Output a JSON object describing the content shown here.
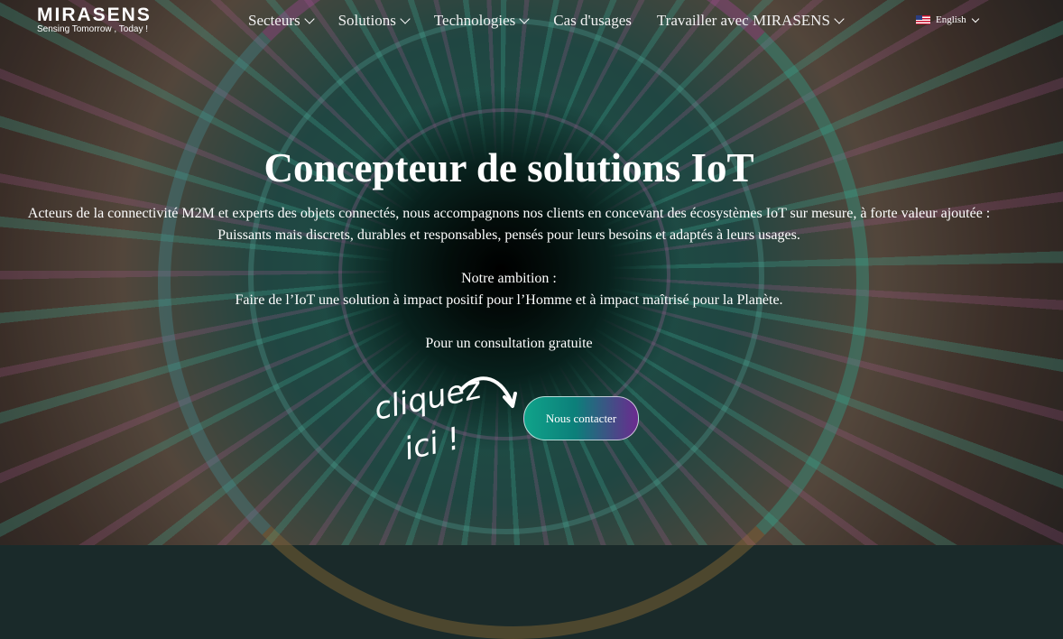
{
  "brand": {
    "name": "MIRASENS",
    "tagline": "Sensing Tomorrow , Today !"
  },
  "nav": {
    "items": [
      {
        "label": "Secteurs",
        "has_dropdown": true
      },
      {
        "label": "Solutions",
        "has_dropdown": true
      },
      {
        "label": "Technologies",
        "has_dropdown": true
      },
      {
        "label": "Cas d'usages",
        "has_dropdown": false
      },
      {
        "label": "Travailler avec MIRASENS",
        "has_dropdown": true
      }
    ],
    "language": {
      "label": "English",
      "icon": "us-flag-icon"
    }
  },
  "hero": {
    "title": "Concepteur de solutions IoT",
    "intro_line1": "Acteurs de la connectivité M2M et experts des objets connectés, nous accompagnons nos clients en concevant des écosystèmes IoT sur mesure, à forte valeur ajoutée :",
    "intro_line2": "Puissants mais discrets, durables et responsables, pensés pour leurs besoins et adaptés à leurs usages.",
    "ambition_label": "Notre ambition :",
    "ambition_text": "Faire de l’IoT une solution à impact positif pour l’Homme et à impact maîtrisé pour la Planète.",
    "consult_text": "Pour un consultation gratuite",
    "cliquez_line1": "cliquez",
    "cliquez_line2": "ici !",
    "cta_label": "Nous contacter"
  },
  "colors": {
    "cta_start": "#10a38a",
    "cta_end": "#6b2a8f"
  }
}
